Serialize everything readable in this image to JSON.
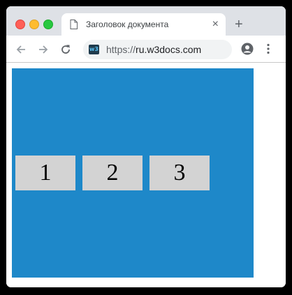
{
  "browser": {
    "tab_title": "Заголовок документа",
    "tab_close": "×",
    "new_tab": "+",
    "url_scheme": "https://",
    "url_host": "ru.w3docs.com",
    "site_icon": "w3",
    "icons": [
      "document-icon",
      "back-arrow-icon",
      "forward-arrow-icon",
      "reload-icon",
      "profile-icon",
      "more-menu-icon"
    ]
  },
  "page": {
    "background": "#1e88c9",
    "boxes": [
      "1",
      "2",
      "3"
    ]
  }
}
